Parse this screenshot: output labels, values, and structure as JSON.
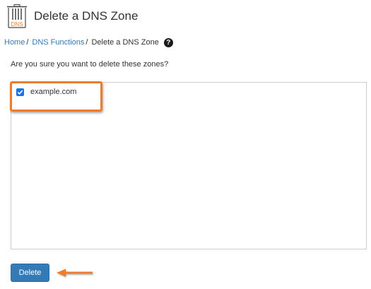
{
  "header": {
    "title": "Delete a DNS Zone",
    "logo_text": "DNS",
    "logo_icon": "dns-trash-icon"
  },
  "breadcrumb": {
    "items": [
      {
        "label": "Home"
      },
      {
        "label": "DNS Functions"
      }
    ],
    "separator": "/",
    "current": "Delete a DNS Zone",
    "help_icon": "question-circle-icon"
  },
  "main": {
    "prompt": "Are you sure you want to delete these zones?",
    "zones": [
      {
        "name": "example.com",
        "checked": true
      }
    ],
    "delete_label": "Delete"
  },
  "annotations": {
    "highlight_color": "#ef7c2a"
  },
  "colors": {
    "link": "#337ab7",
    "button": "#337ab7",
    "accent": "#ef7c2a"
  }
}
